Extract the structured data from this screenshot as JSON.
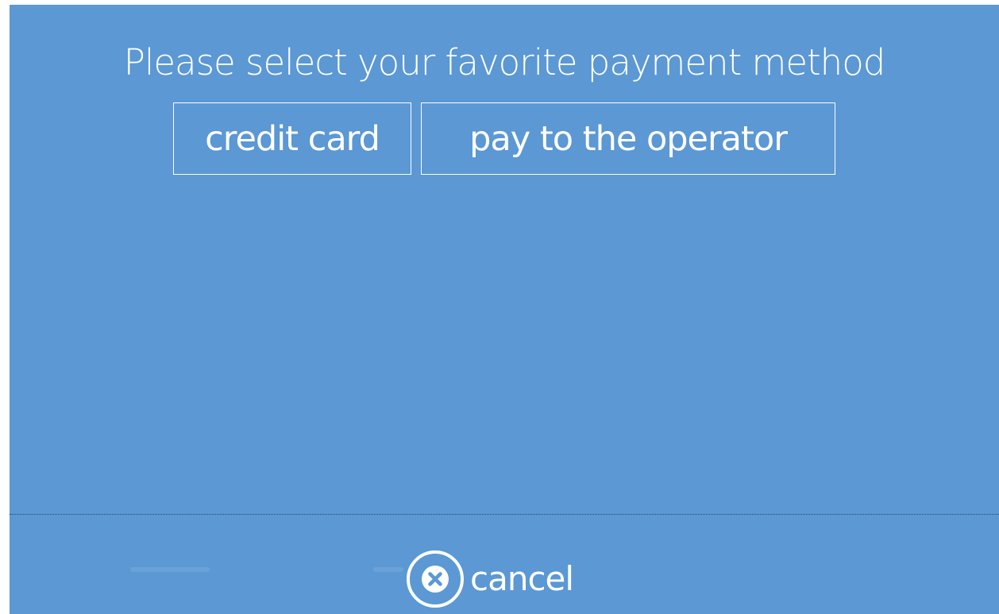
{
  "prompt": {
    "title": "Please select your favorite payment method"
  },
  "payment_options": [
    {
      "label": "credit card"
    },
    {
      "label": "pay to the operator"
    }
  ],
  "footer": {
    "cancel_label": "cancel",
    "cancel_icon": "close-circle-icon"
  },
  "colors": {
    "background": "#5b98d4",
    "text": "#ffffff",
    "divider": "#2a4a6a"
  }
}
